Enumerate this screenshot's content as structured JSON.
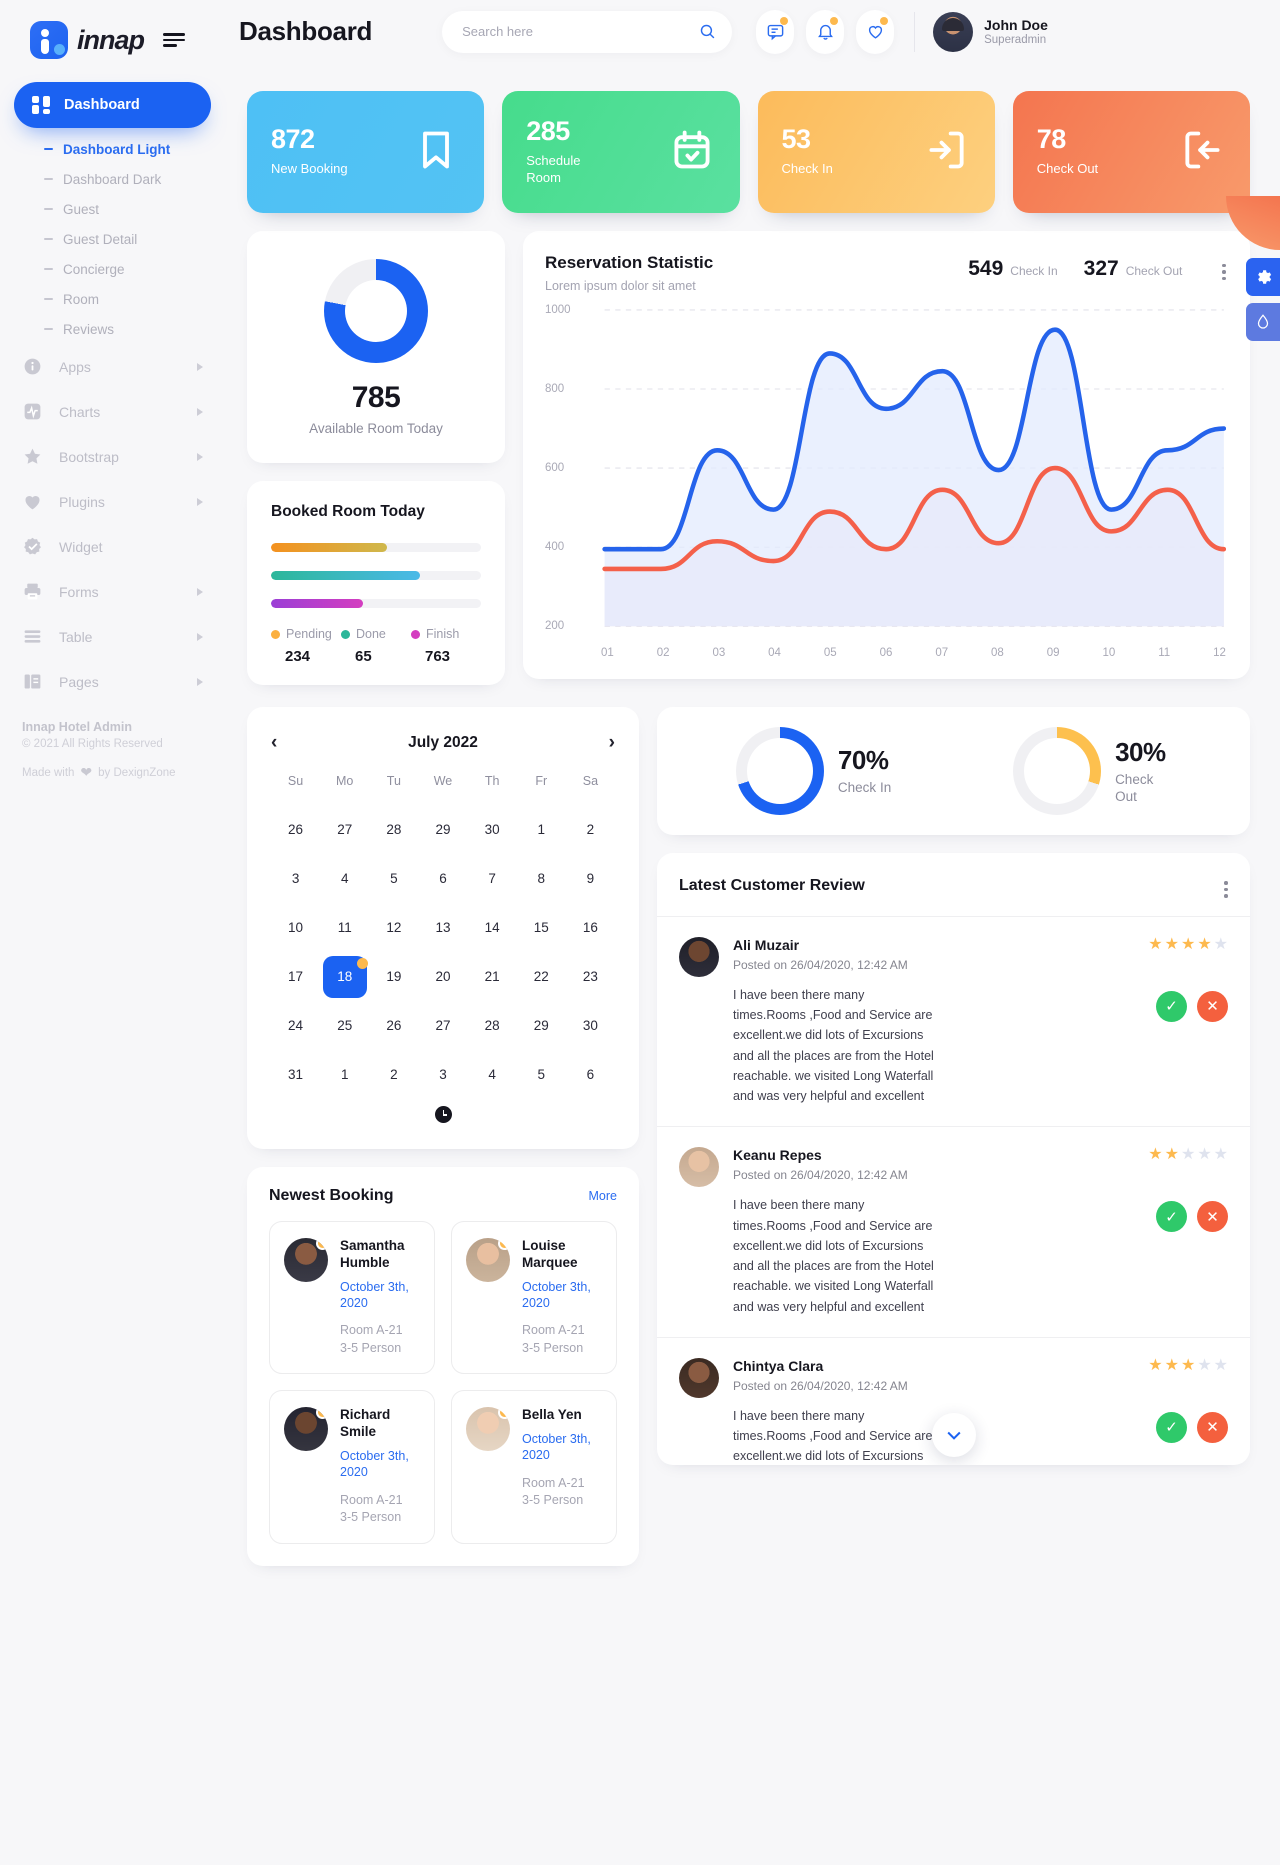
{
  "brand": {
    "name": "innap",
    "logo_icon": "innap-logo-icon",
    "menu_icon": "hamburger-icon"
  },
  "sidebar": {
    "main_item": {
      "label": "Dashboard",
      "icon": "grid-icon"
    },
    "sub_items": [
      {
        "label": "Dashboard Light",
        "active": true
      },
      {
        "label": "Dashboard Dark",
        "active": false
      },
      {
        "label": "Guest",
        "active": false
      },
      {
        "label": "Guest Detail",
        "active": false
      },
      {
        "label": "Concierge",
        "active": false
      },
      {
        "label": "Room",
        "active": false
      },
      {
        "label": "Reviews",
        "active": false
      }
    ],
    "groups": [
      {
        "label": "Apps",
        "icon": "info-circle-icon",
        "has_caret": true
      },
      {
        "label": "Charts",
        "icon": "pulse-icon",
        "has_caret": true
      },
      {
        "label": "Bootstrap",
        "icon": "star-icon",
        "has_caret": true
      },
      {
        "label": "Plugins",
        "icon": "heart-icon",
        "has_caret": true
      },
      {
        "label": "Widget",
        "icon": "badge-check-icon",
        "has_caret": false
      },
      {
        "label": "Forms",
        "icon": "printer-icon",
        "has_caret": true
      },
      {
        "label": "Table",
        "icon": "table-icon",
        "has_caret": true
      },
      {
        "label": "Pages",
        "icon": "pages-icon",
        "has_caret": true
      }
    ],
    "footer": {
      "title": "Innap Hotel Admin",
      "copyright": "© 2021 All Rights Reserved",
      "made_prefix": "Made with",
      "made_suffix": "by DexignZone",
      "heart_icon": "heart-icon"
    }
  },
  "header": {
    "page_title": "Dashboard",
    "search": {
      "placeholder": "Search here",
      "value": "",
      "icon": "search-icon"
    },
    "icons": [
      {
        "name": "messages-icon",
        "badge": true
      },
      {
        "name": "bell-icon",
        "badge": true
      },
      {
        "name": "heart-icon",
        "badge": true
      }
    ],
    "user": {
      "name": "John Doe",
      "role": "Superadmin",
      "avatar": "avatar"
    }
  },
  "stats": [
    {
      "value": "872",
      "label": "New Booking",
      "icon": "bookmark-icon",
      "color": "#4ec0f5"
    },
    {
      "value": "285",
      "label": "Schedule Room",
      "icon": "calendar-check-icon",
      "color": "#46dc8c"
    },
    {
      "value": "53",
      "label": "Check In",
      "icon": "login-icon",
      "color": "#fcbb5b"
    },
    {
      "value": "78",
      "label": "Check Out",
      "icon": "logout-icon",
      "color": "#f4754f"
    }
  ],
  "available_room": {
    "value": "785",
    "label": "Available Room Today",
    "percent": 78,
    "color": "#1b62f2"
  },
  "booked_room": {
    "title": "Booked Room Today",
    "bars": [
      {
        "percent": 55
      },
      {
        "percent": 71
      },
      {
        "percent": 44
      }
    ],
    "legend": [
      {
        "label": "Pending",
        "value": "234",
        "color": "#fbb040"
      },
      {
        "label": "Done",
        "value": "65",
        "color": "#2cb79a"
      },
      {
        "label": "Finish",
        "value": "763",
        "color": "#d43ec0"
      }
    ]
  },
  "reservation": {
    "title": "Reservation Statistic",
    "subtitle": "Lorem ipsum dolor sit amet",
    "check_in_value": "549",
    "check_in_label": "Check In",
    "check_out_value": "327",
    "check_out_label": "Check Out",
    "menu_icon": "kebab-menu-icon"
  },
  "chart_data": {
    "type": "area",
    "title": "Reservation Statistic",
    "subtitle": "Lorem ipsum dolor sit amet",
    "xlabel": "",
    "ylabel": "",
    "ylim": [
      200,
      1000
    ],
    "yticks": [
      200,
      400,
      600,
      800,
      1000
    ],
    "grid": true,
    "legend": "none",
    "categories": [
      "01",
      "02",
      "03",
      "04",
      "05",
      "06",
      "07",
      "08",
      "09",
      "10",
      "11",
      "12"
    ],
    "series": [
      {
        "name": "Check In",
        "color": "#2563eb",
        "fill": "#e3ebfd",
        "values": [
          395,
          395,
          645,
          495,
          890,
          750,
          845,
          595,
          950,
          495,
          645,
          700
        ]
      },
      {
        "name": "Check Out",
        "color": "#f4604a",
        "fill": "#f3e6ee",
        "values": [
          345,
          345,
          415,
          365,
          490,
          395,
          545,
          410,
          600,
          440,
          545,
          395
        ]
      }
    ]
  },
  "calendar": {
    "month_label": "July 2022",
    "prev_icon": "chevron-left-icon",
    "next_icon": "chevron-right-icon",
    "clock_icon": "clock-icon",
    "dow": [
      "Su",
      "Mo",
      "Tu",
      "We",
      "Th",
      "Fr",
      "Sa"
    ],
    "weeks": [
      [
        {
          "d": "26",
          "o": true
        },
        {
          "d": "27",
          "o": true
        },
        {
          "d": "28",
          "o": true
        },
        {
          "d": "29",
          "o": true
        },
        {
          "d": "30",
          "o": true
        },
        {
          "d": "1"
        },
        {
          "d": "2"
        }
      ],
      [
        {
          "d": "3"
        },
        {
          "d": "4"
        },
        {
          "d": "5"
        },
        {
          "d": "6"
        },
        {
          "d": "7"
        },
        {
          "d": "8"
        },
        {
          "d": "9"
        }
      ],
      [
        {
          "d": "10"
        },
        {
          "d": "11"
        },
        {
          "d": "12"
        },
        {
          "d": "13"
        },
        {
          "d": "14"
        },
        {
          "d": "15"
        },
        {
          "d": "16"
        }
      ],
      [
        {
          "d": "17"
        },
        {
          "d": "18",
          "sel": true
        },
        {
          "d": "19"
        },
        {
          "d": "20"
        },
        {
          "d": "21"
        },
        {
          "d": "22"
        },
        {
          "d": "23"
        }
      ],
      [
        {
          "d": "24"
        },
        {
          "d": "25"
        },
        {
          "d": "26"
        },
        {
          "d": "27"
        },
        {
          "d": "28"
        },
        {
          "d": "29"
        },
        {
          "d": "30"
        }
      ],
      [
        {
          "d": "31"
        },
        {
          "d": "1",
          "o": true
        },
        {
          "d": "2",
          "o": true
        },
        {
          "d": "3",
          "o": true
        },
        {
          "d": "4",
          "o": true
        },
        {
          "d": "5",
          "o": true
        },
        {
          "d": "6",
          "o": true
        }
      ]
    ]
  },
  "newest_booking": {
    "title": "Newest Booking",
    "more_label": "More",
    "items": [
      {
        "name": "Samantha Humble",
        "date": "October 3th, 2020",
        "room": "Room A-21",
        "persons": "3-5 Person"
      },
      {
        "name": "Louise Marquee",
        "date": "October 3th, 2020",
        "room": "Room A-21",
        "persons": "3-5 Person"
      },
      {
        "name": "Richard Smile",
        "date": "October 3th, 2020",
        "room": "Room A-21",
        "persons": "3-5 Person"
      },
      {
        "name": "Bella Yen",
        "date": "October 3th, 2020",
        "room": "Room A-21",
        "persons": "3-5 Person"
      }
    ]
  },
  "percent_cards": [
    {
      "value": "70%",
      "label": "Check In",
      "percent": 70,
      "color": "#1b62f2"
    },
    {
      "value": "30%",
      "label": "Check Out",
      "percent": 30,
      "color": "#fdc04e"
    }
  ],
  "reviews": {
    "title": "Latest Customer Review",
    "menu_icon": "kebab-menu-icon",
    "accept_icon": "check-circle-icon",
    "reject_icon": "x-circle-icon",
    "scroll_icon": "chevron-down-icon",
    "items": [
      {
        "name": "Ali Muzair",
        "posted": "Posted on 26/04/2020, 12:42 AM",
        "stars": 4,
        "text": "I have been there many times.Rooms ,Food and Service are excellent.we did lots of Excursions and all the places are from the Hotel reachable. we visited Long Waterfall and was very helpful and excellent"
      },
      {
        "name": "Keanu Repes",
        "posted": "Posted on 26/04/2020, 12:42 AM",
        "stars": 2,
        "text": "I have been there many times.Rooms ,Food and Service are excellent.we did lots of Excursions and all the places are from the Hotel reachable. we visited Long Waterfall and was very helpful and excellent"
      },
      {
        "name": "Chintya Clara",
        "posted": "Posted on 26/04/2020, 12:42 AM",
        "stars": 3,
        "text": "I have been there many times.Rooms ,Food and Service are excellent.we did lots of Excursions and all the places are from the Hotel reachable."
      }
    ]
  },
  "side_fabs": [
    {
      "name": "settings-fab",
      "icon": "gear-icon"
    },
    {
      "name": "theme-fab",
      "icon": "droplet-icon"
    }
  ]
}
